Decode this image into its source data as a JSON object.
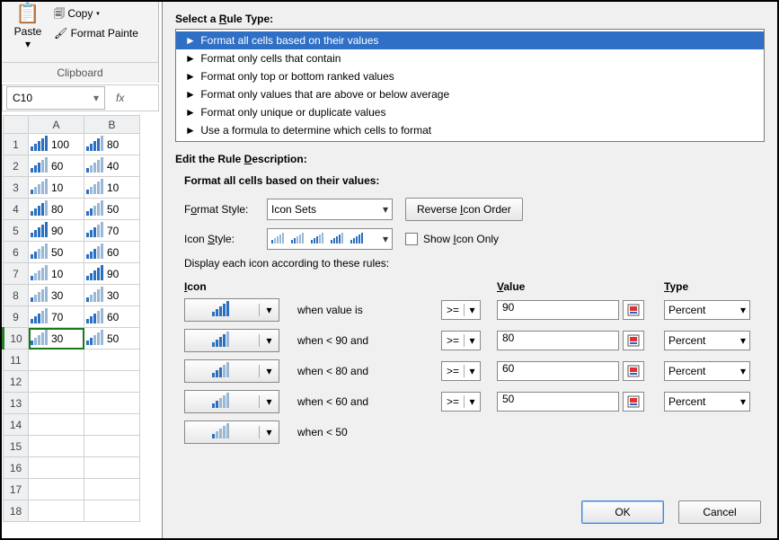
{
  "ribbon": {
    "paste_label": "Paste",
    "copy_label": "Copy",
    "format_painter_label": "Format Painte",
    "group_label": "Clipboard"
  },
  "namebox": {
    "value": "C10",
    "fx": "fx"
  },
  "grid": {
    "columns": [
      "A",
      "B"
    ],
    "rows": [
      {
        "h": "1",
        "cells": [
          {
            "icon": 5,
            "v": "100"
          },
          {
            "icon": 4,
            "v": "80"
          }
        ]
      },
      {
        "h": "2",
        "cells": [
          {
            "icon": 3,
            "v": "60"
          },
          {
            "icon": 1,
            "v": "40"
          }
        ]
      },
      {
        "h": "3",
        "cells": [
          {
            "icon": 1,
            "v": "10"
          },
          {
            "icon": 1,
            "v": "10"
          }
        ]
      },
      {
        "h": "4",
        "cells": [
          {
            "icon": 4,
            "v": "80"
          },
          {
            "icon": 2,
            "v": "50"
          }
        ]
      },
      {
        "h": "5",
        "cells": [
          {
            "icon": 5,
            "v": "90"
          },
          {
            "icon": 3,
            "v": "70"
          }
        ]
      },
      {
        "h": "6",
        "cells": [
          {
            "icon": 2,
            "v": "50"
          },
          {
            "icon": 3,
            "v": "60"
          }
        ]
      },
      {
        "h": "7",
        "cells": [
          {
            "icon": 1,
            "v": "10"
          },
          {
            "icon": 5,
            "v": "90"
          }
        ]
      },
      {
        "h": "8",
        "cells": [
          {
            "icon": 1,
            "v": "30"
          },
          {
            "icon": 1,
            "v": "30"
          }
        ]
      },
      {
        "h": "9",
        "cells": [
          {
            "icon": 3,
            "v": "70"
          },
          {
            "icon": 3,
            "v": "60"
          }
        ]
      },
      {
        "h": "10",
        "sel": true,
        "cells": [
          {
            "icon": 1,
            "v": "30"
          },
          {
            "icon": 2,
            "v": "50"
          }
        ]
      },
      {
        "h": "11",
        "cells": [
          {
            "v": ""
          },
          {
            "v": ""
          }
        ]
      },
      {
        "h": "12",
        "cells": [
          {
            "v": ""
          },
          {
            "v": ""
          }
        ]
      },
      {
        "h": "13",
        "cells": [
          {
            "v": ""
          },
          {
            "v": ""
          }
        ]
      },
      {
        "h": "14",
        "cells": [
          {
            "v": ""
          },
          {
            "v": ""
          }
        ]
      },
      {
        "h": "15",
        "cells": [
          {
            "v": ""
          },
          {
            "v": ""
          }
        ]
      },
      {
        "h": "16",
        "cells": [
          {
            "v": ""
          },
          {
            "v": ""
          }
        ]
      },
      {
        "h": "17",
        "cells": [
          {
            "v": ""
          },
          {
            "v": ""
          }
        ]
      },
      {
        "h": "18",
        "cells": [
          {
            "v": ""
          },
          {
            "v": ""
          }
        ]
      }
    ]
  },
  "dialog": {
    "select_label": "Select a Rule Type:",
    "rule_types": [
      "Format all cells based on their values",
      "Format only cells that contain",
      "Format only top or bottom ranked values",
      "Format only values that are above or below average",
      "Format only unique or duplicate values",
      "Use a formula to determine which cells to format"
    ],
    "selected_rule_index": 0,
    "edit_label": "Edit the Rule Description:",
    "desc_title": "Format all cells based on their values:",
    "format_style_label": "Format Style:",
    "format_style_value": "Icon Sets",
    "reverse_label": "Reverse Icon Order",
    "icon_style_label": "Icon Style:",
    "show_icon_only_label": "Show Icon Only",
    "display_rules_label": "Display each icon according to these rules:",
    "hdr_icon": "Icon",
    "hdr_value": "Value",
    "hdr_type": "Type",
    "rules": [
      {
        "icon_level": 5,
        "when": "when value is",
        "op": ">=",
        "value": "90",
        "type": "Percent"
      },
      {
        "icon_level": 4,
        "when": "when < 90 and",
        "op": ">=",
        "value": "80",
        "type": "Percent"
      },
      {
        "icon_level": 3,
        "when": "when < 80 and",
        "op": ">=",
        "value": "60",
        "type": "Percent"
      },
      {
        "icon_level": 2,
        "when": "when < 60 and",
        "op": ">=",
        "value": "50",
        "type": "Percent"
      },
      {
        "icon_level": 1,
        "when": "when < 50",
        "op": "",
        "value": "",
        "type": ""
      }
    ],
    "ok_label": "OK",
    "cancel_label": "Cancel"
  },
  "underline_map": {
    "Select a Rule Type:": 9,
    "Edit the Rule Description:": 14,
    "Format Style:": 1,
    "Reverse Icon Order": 8,
    "Icon Style:": 5,
    "Show Icon Only": 5,
    "Icon": 0,
    "Value": 0,
    "Type": 0
  }
}
